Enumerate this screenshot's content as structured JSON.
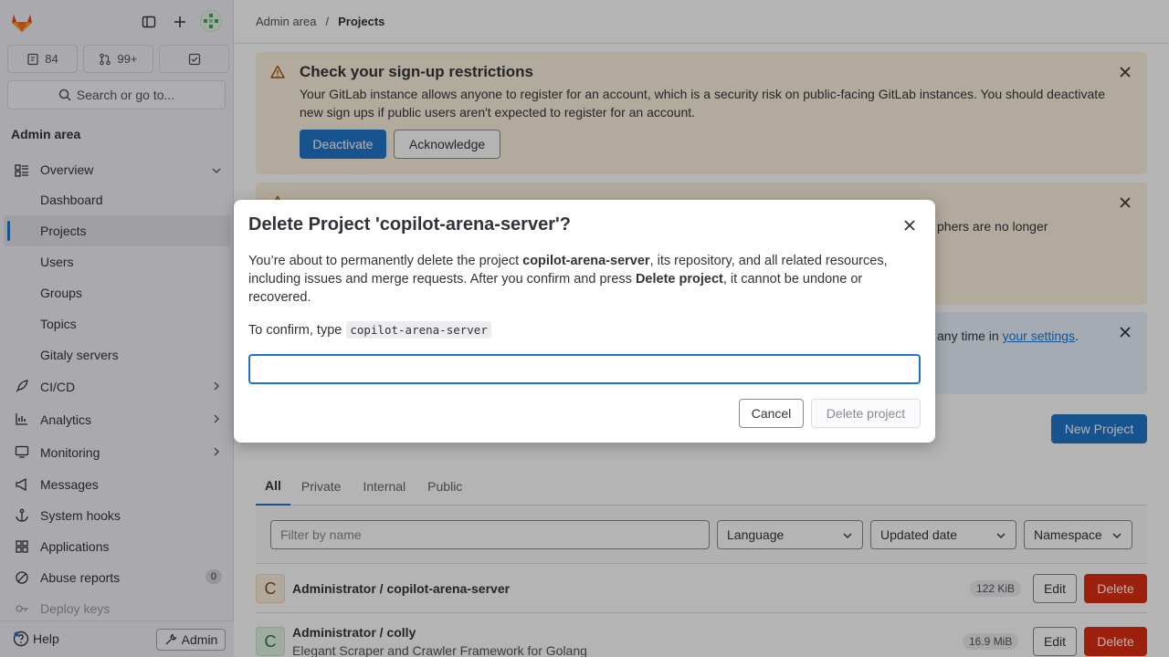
{
  "sidebar": {
    "counts": {
      "issues": "84",
      "merge_requests": "99+"
    },
    "search_label": "Search or go to...",
    "section_title": "Admin area",
    "items": [
      {
        "label": "Overview",
        "icon": "overview-icon"
      },
      {
        "label": "Dashboard"
      },
      {
        "label": "Projects"
      },
      {
        "label": "Users"
      },
      {
        "label": "Groups"
      },
      {
        "label": "Topics"
      },
      {
        "label": "Gitaly servers"
      },
      {
        "label": "CI/CD",
        "icon": "rocket-icon"
      },
      {
        "label": "Analytics",
        "icon": "chart-icon"
      },
      {
        "label": "Monitoring",
        "icon": "monitor-icon"
      },
      {
        "label": "Messages",
        "icon": "bullhorn-icon"
      },
      {
        "label": "System hooks",
        "icon": "anchor-icon"
      },
      {
        "label": "Applications",
        "icon": "grid-icon"
      },
      {
        "label": "Abuse reports",
        "icon": "abuse-icon",
        "badge": "0"
      },
      {
        "label": "Deploy keys",
        "icon": "key-icon"
      }
    ],
    "help_label": "Help",
    "admin_label": "Admin"
  },
  "breadcrumb": {
    "parent": "Admin area",
    "separator": "/",
    "current": "Projects"
  },
  "alerts": {
    "signup": {
      "title": "Check your sign-up restrictions",
      "text": "Your GitLab instance allows anyone to register for an account, which is a security risk on public-facing GitLab instances. You should deactivate new sign ups if public users aren't expected to register for an account.",
      "primary_label": "Deactivate",
      "secondary_label": "Acknowledge"
    },
    "ssh": {
      "partial_text": "phers are no longer"
    },
    "info": {
      "partial_text": "any time in",
      "link_text": "your settings",
      "end": "."
    }
  },
  "new_project_label": "New Project",
  "tabs": [
    "All",
    "Private",
    "Internal",
    "Public"
  ],
  "filters": {
    "name_placeholder": "Filter by name",
    "language": "Language",
    "sort": "Updated date",
    "namespace": "Namespace"
  },
  "projects": [
    {
      "avatar": "C",
      "name": "Administrator / copilot-arena-server",
      "description": "",
      "size": "122 KiB",
      "edit": "Edit",
      "delete": "Delete"
    },
    {
      "avatar": "C",
      "name": "Administrator / colly",
      "description": "Elegant Scraper and Crawler Framework for Golang",
      "size": "16.9 MiB",
      "edit": "Edit",
      "delete": "Delete"
    }
  ],
  "modal": {
    "title": "Delete Project 'copilot-arena-server'?",
    "body_1": "You’re about to permanently delete the project ",
    "body_project": "copilot-arena-server",
    "body_2": ", its repository, and all related resources, including issues and merge requests. After you confirm and press ",
    "body_action": "Delete project",
    "body_3": ", it cannot be undone or recovered.",
    "confirm_label": "To confirm, type",
    "confirm_code": "copilot-arena-server",
    "input_value": "",
    "cancel_label": "Cancel",
    "delete_label": "Delete project"
  },
  "colors": {
    "primary": "#1f75cb",
    "danger": "#dd2b0e",
    "warning_bg": "#fdf1dd",
    "info_bg": "#e9f3fc"
  }
}
